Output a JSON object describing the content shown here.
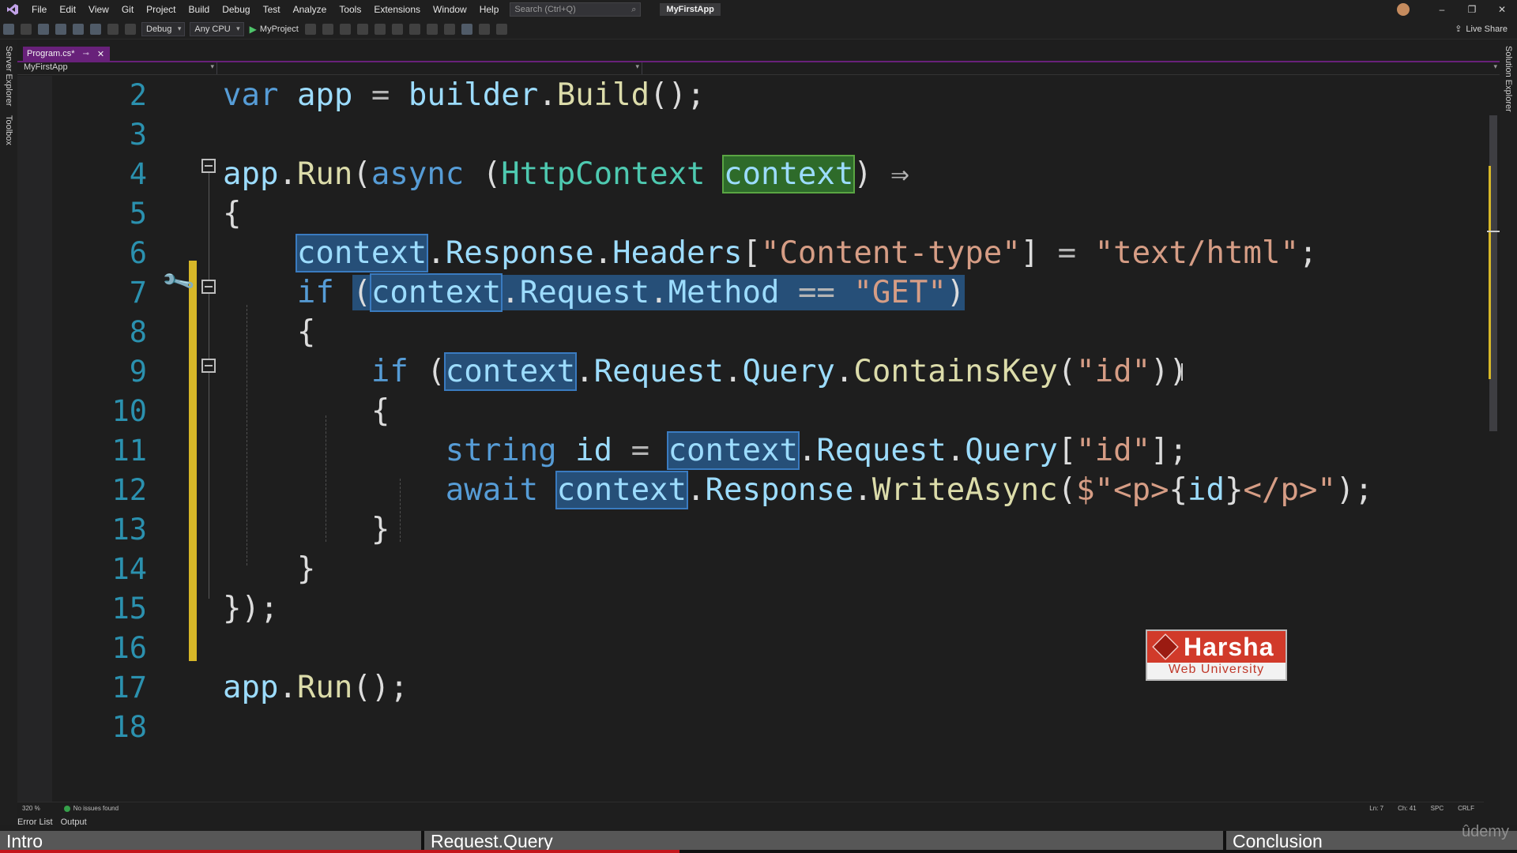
{
  "menubar": {
    "items": [
      "File",
      "Edit",
      "View",
      "Git",
      "Project",
      "Build",
      "Debug",
      "Test",
      "Analyze",
      "Tools",
      "Extensions",
      "Window",
      "Help"
    ],
    "search_placeholder": "Search (Ctrl+Q)",
    "app_title": "MyFirstApp"
  },
  "toolbar": {
    "config": "Debug",
    "platform": "Any CPU",
    "run_target": "MyProject",
    "live_share": "Live Share"
  },
  "sidebars": {
    "left": [
      "Server Explorer",
      "Toolbox"
    ],
    "right": [
      "Solution Explorer"
    ]
  },
  "tab": {
    "label": "Program.cs*"
  },
  "nav": {
    "project": "MyFirstApp"
  },
  "code": {
    "line_numbers": [
      "2",
      "3",
      "4",
      "5",
      "6",
      "7",
      "8",
      "9",
      "10",
      "11",
      "12",
      "13",
      "14",
      "15",
      "16",
      "17",
      "18"
    ]
  },
  "watermark": {
    "name": "Harsha",
    "sub": "Web University"
  },
  "status": {
    "zoom": "320 %",
    "issues": "No issues found",
    "ln": "Ln: 7",
    "ch": "Ch: 41",
    "spc": "SPC",
    "eol": "CRLF"
  },
  "bottom_tabs": [
    "Error List",
    "Output"
  ],
  "chapters": [
    "Intro",
    "Request.Query",
    "Conclusion"
  ],
  "video": {
    "progress_fraction": 0.448,
    "brand": "ûdemy"
  },
  "colors": {
    "tab_accent": "#68217a",
    "change_bar": "#d7b728",
    "highlight": "#264f78",
    "progress": "#c4161c"
  }
}
